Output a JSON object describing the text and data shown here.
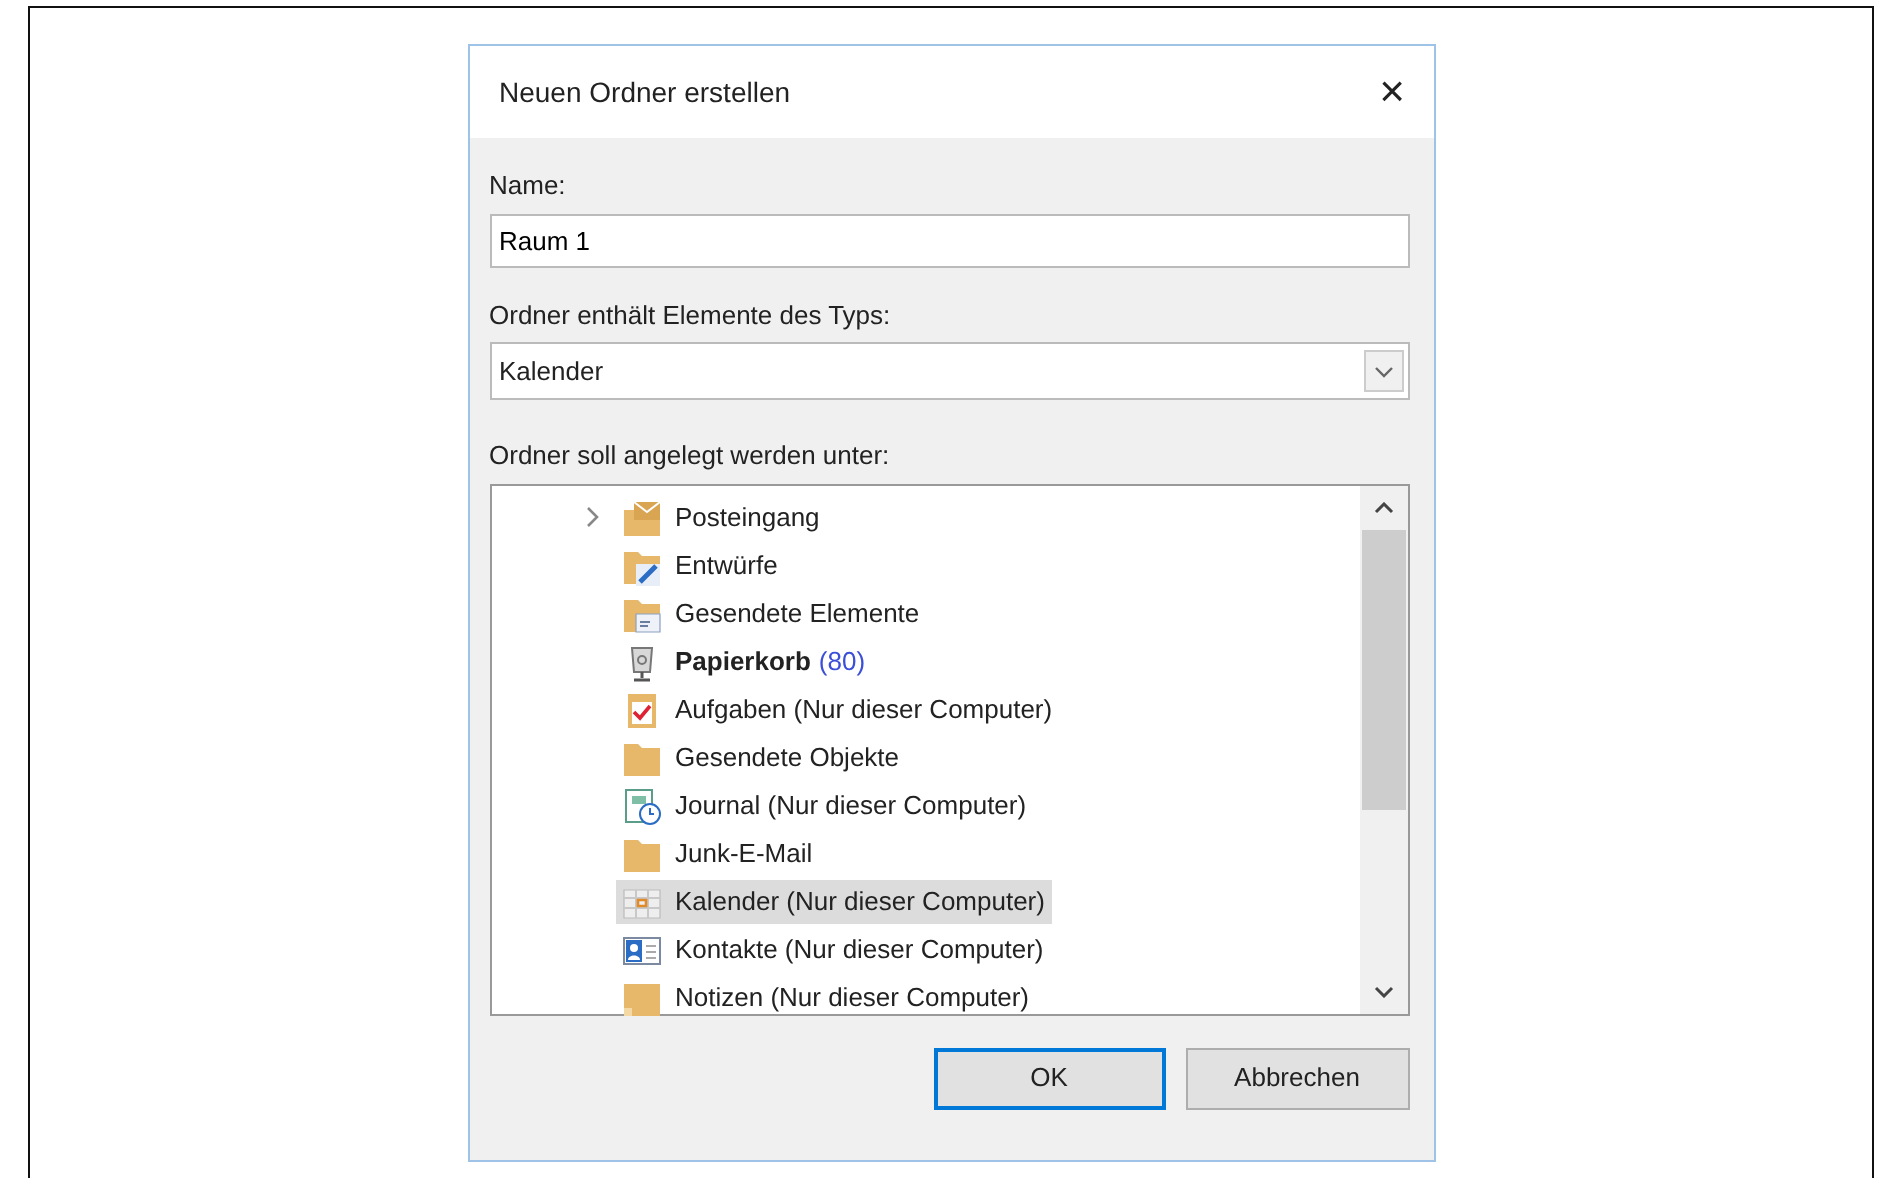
{
  "dialog": {
    "title": "Neuen Ordner erstellen",
    "close": "×"
  },
  "name_field": {
    "label": "Name:",
    "value": "Raum 1"
  },
  "type_field": {
    "label": "Ordner enthält Elemente des Typs:",
    "value": "Kalender"
  },
  "tree": {
    "label": "Ordner soll angelegt werden unter:",
    "items": [
      {
        "kind": "inbox",
        "label": "Posteingang",
        "expandable": true,
        "bold": false,
        "selected": false
      },
      {
        "kind": "drafts",
        "label": "Entwürfe",
        "expandable": false,
        "bold": false,
        "selected": false
      },
      {
        "kind": "sent",
        "label": "Gesendete Elemente",
        "expandable": false,
        "bold": false,
        "selected": false
      },
      {
        "kind": "trash",
        "label": "Papierkorb",
        "count": "(80)",
        "expandable": false,
        "bold": true,
        "selected": false
      },
      {
        "kind": "tasks",
        "label": "Aufgaben (Nur dieser Computer)",
        "expandable": false,
        "bold": false,
        "selected": false
      },
      {
        "kind": "folder",
        "label": "Gesendete Objekte",
        "expandable": false,
        "bold": false,
        "selected": false
      },
      {
        "kind": "journal",
        "label": "Journal (Nur dieser Computer)",
        "expandable": false,
        "bold": false,
        "selected": false
      },
      {
        "kind": "folder",
        "label": "Junk-E-Mail",
        "expandable": false,
        "bold": false,
        "selected": false
      },
      {
        "kind": "calendar",
        "label": "Kalender (Nur dieser Computer)",
        "expandable": false,
        "bold": false,
        "selected": true
      },
      {
        "kind": "contacts",
        "label": "Kontakte (Nur dieser Computer)",
        "expandable": false,
        "bold": false,
        "selected": false
      },
      {
        "kind": "notes",
        "label": "Notizen (Nur dieser Computer)",
        "expandable": false,
        "bold": false,
        "selected": false
      }
    ]
  },
  "buttons": [
    {
      "label": "OK",
      "default": true
    },
    {
      "label": "Abbrechen",
      "default": false
    }
  ]
}
